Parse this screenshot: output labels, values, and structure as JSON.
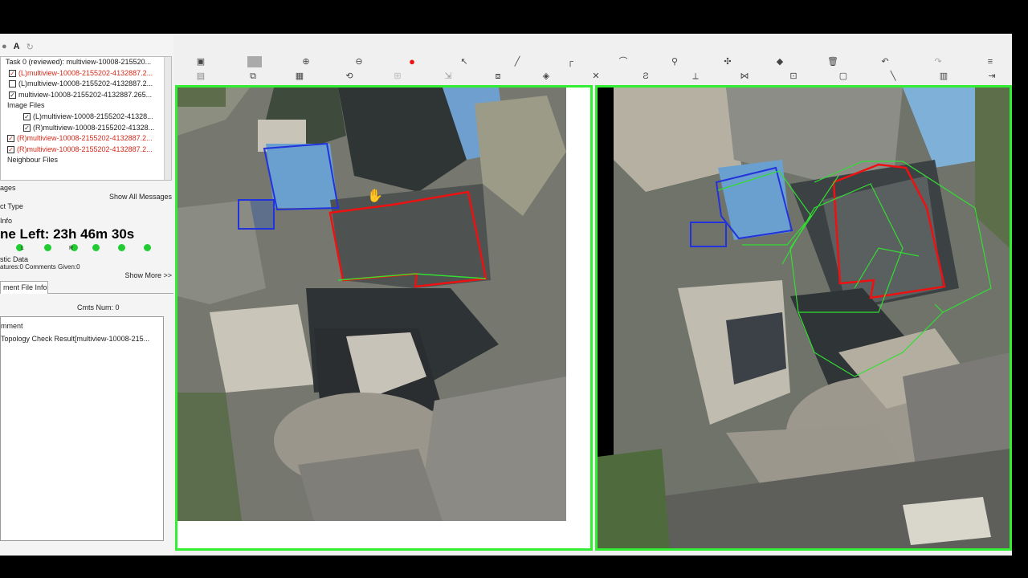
{
  "toolbar_top": {
    "letter": "A"
  },
  "tree": {
    "items": [
      {
        "check": "",
        "label": "Task 0 (reviewed): multiview-10008-215520...",
        "color": "normal"
      },
      {
        "check": "✓",
        "label": "(L)multiview-10008-2155202-4132887.2...",
        "color": "red"
      },
      {
        "check": "",
        "label": "(L)multiview-10008-2155202-4132887.2...",
        "color": "normal"
      },
      {
        "check": "✓",
        "label": "multiview-10008-2155202-4132887.265...",
        "color": "normal"
      },
      {
        "check": "",
        "label": "Image Files",
        "color": "normal"
      },
      {
        "check": "✓",
        "label": "(L)multiview-10008-2155202-41328...",
        "color": "normal"
      },
      {
        "check": "✓",
        "label": "(R)multiview-10008-2155202-41328...",
        "color": "normal"
      },
      {
        "check": "✓",
        "label": "(R)multiview-10008-2155202-4132887.2...",
        "color": "red"
      },
      {
        "check": "✓",
        "label": "(R)multiview-10008-2155202-4132887.2...",
        "color": "red"
      },
      {
        "check": "",
        "label": "Neighbour Files",
        "color": "normal"
      }
    ]
  },
  "panel": {
    "images_label": "ages",
    "show_all_messages": "Show All Messages",
    "object_type_label": "ct Type",
    "info_label": "Info",
    "time_left": "ne Left: 23h 46m 30s",
    "dot_labels": [
      "L",
      "R"
    ],
    "statistic_label": "stic Data",
    "stats_text": "atures:0 Comments Given:0",
    "show_more": "Show More >>",
    "tab_label": "ment File Info",
    "comments_num": "Cmts Num: 0",
    "comment_header": "mment",
    "topology_result": "Topology Check Result[multiview-10008-215..."
  },
  "colors": {
    "view_border": "#33ee33",
    "polygon_red": "#ee1111",
    "polygon_blue": "#2233dd",
    "polygon_green": "#33dd33",
    "record": "#ee1111"
  },
  "icons": {
    "toolbar_row1": [
      "save-icon",
      "image-icon",
      "zoom-in-icon",
      "zoom-out-icon",
      "record-icon",
      "pointer-icon",
      "pen-icon",
      "corner-icon",
      "arc-icon",
      "pin-icon",
      "split-icon",
      "eraser-icon",
      "delete-icon",
      "undo-icon",
      "redo-icon",
      "menu-icon"
    ],
    "toolbar_row2": [
      "save-as-icon",
      "layers-icon",
      "stamp-icon",
      "rotate-icon",
      "grid-icon",
      "export-icon",
      "frame-icon",
      "fill-icon",
      "cut-icon",
      "zigzag-icon",
      "edge-icon",
      "crossing-icon",
      "transform-icon",
      "box-icon",
      "line-icon",
      "column-icon",
      "align-icon"
    ]
  }
}
